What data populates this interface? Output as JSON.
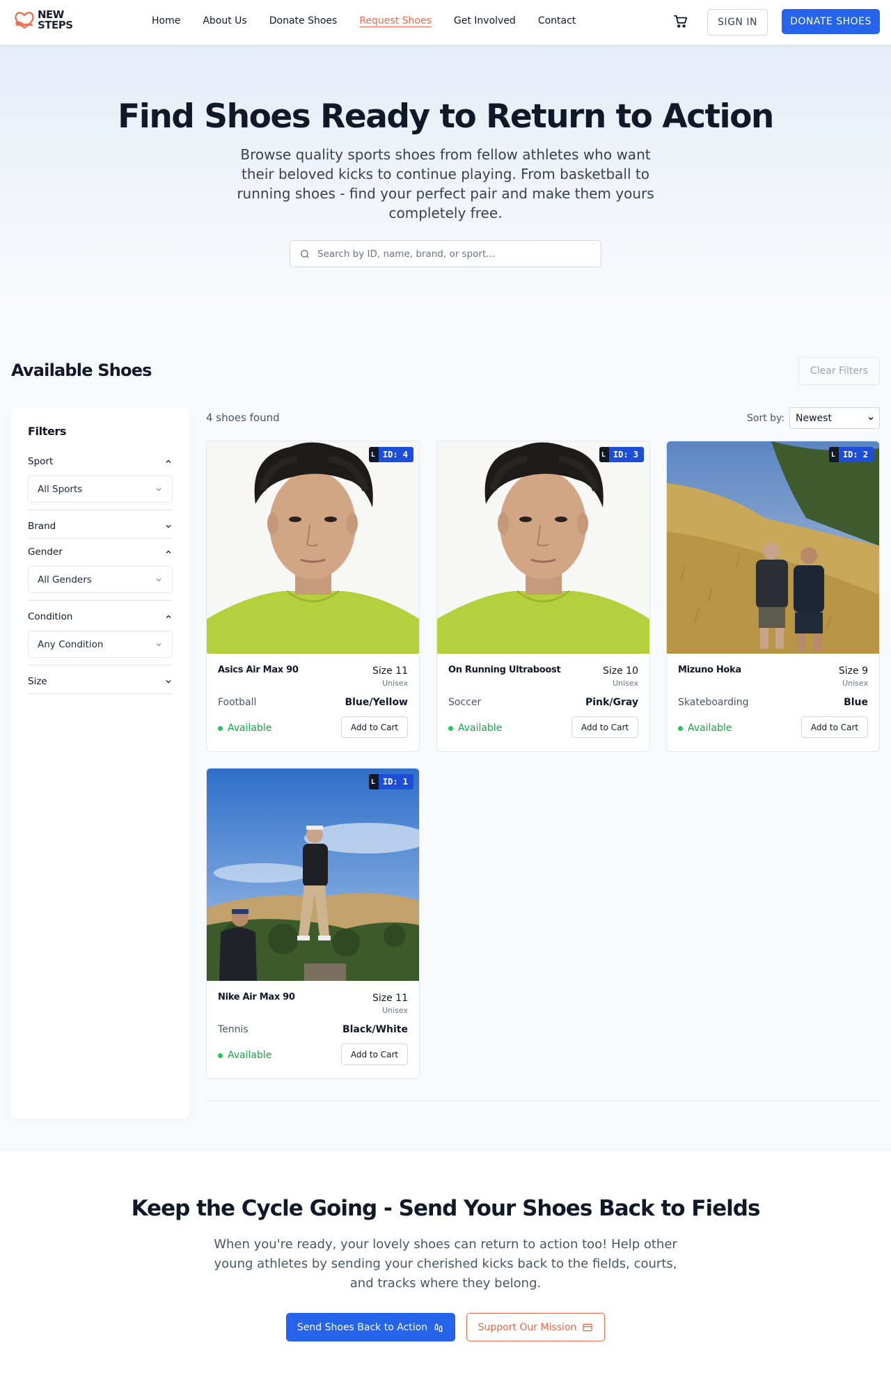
{
  "nav": {
    "logo": {
      "line1": "NEW",
      "line2": "STEPS",
      "icon": "heart-shoe-icon"
    },
    "links": [
      "Home",
      "About Us",
      "Donate Shoes",
      "Request Shoes",
      "Get Involved",
      "Contact"
    ],
    "active_link": "Request Shoes",
    "cart_icon": "cart-icon",
    "sign_in": "SIGN IN",
    "donate": "DONATE SHOES"
  },
  "hero": {
    "title": "Find Shoes Ready to Return to Action",
    "subtitle": "Browse quality sports shoes from fellow athletes who want their beloved kicks to continue playing. From basketball to running shoes - find your perfect pair and make them yours completely free.",
    "search_placeholder": "Search by ID, name, brand, or sport..."
  },
  "listing": {
    "title": "Available Shoes",
    "clear_filters": "Clear Filters",
    "count_text": "4 shoes found",
    "sort_label": "Sort by:",
    "sort_value": "Newest"
  },
  "filters": {
    "title": "Filters",
    "groups": [
      {
        "label": "Sport",
        "expanded": true,
        "value": "All Sports"
      },
      {
        "label": "Brand",
        "expanded": false
      },
      {
        "label": "Gender",
        "expanded": true,
        "value": "All Genders"
      },
      {
        "label": "Condition",
        "expanded": true,
        "value": "Any Condition"
      },
      {
        "label": "Size",
        "expanded": false
      }
    ]
  },
  "shoes": [
    {
      "id_label": "ID: 4",
      "name": "Asics Air Max 90",
      "size": "Size 11",
      "gender": "Unisex",
      "sport": "Football",
      "color": "Blue/Yellow",
      "status": "Available",
      "add": "Add to Cart",
      "photo": "portrait"
    },
    {
      "id_label": "ID: 3",
      "name": "On Running Ultraboost",
      "size": "Size 10",
      "gender": "Unisex",
      "sport": "Soccer",
      "color": "Pink/Gray",
      "status": "Available",
      "add": "Add to Cart",
      "photo": "portrait"
    },
    {
      "id_label": "ID: 2",
      "name": "Mizuno Hoka",
      "size": "Size 9",
      "gender": "Unisex",
      "sport": "Skateboarding",
      "color": "Blue",
      "status": "Available",
      "add": "Add to Cart",
      "photo": "hiking"
    },
    {
      "id_label": "ID: 1",
      "name": "Nike Air Max 90",
      "size": "Size 11",
      "gender": "Unisex",
      "sport": "Tennis",
      "color": "Black/White",
      "status": "Available",
      "add": "Add to Cart",
      "photo": "hilltop"
    }
  ],
  "cta": {
    "title": "Keep the Cycle Going - Send Your Shoes Back to Fields",
    "text": "When you're ready, your lovely shoes can return to action too! Help other young athletes by sending your cherished kicks back to the fields, courts, and tracks where they belong.",
    "primary": "Send Shoes Back to Action",
    "secondary": "Support Our Mission"
  },
  "colors": {
    "brand_blue": "#2563eb",
    "accent_orange": "#f2684a",
    "available_green": "#16a34a",
    "id_badge": "#1d4ed8"
  }
}
